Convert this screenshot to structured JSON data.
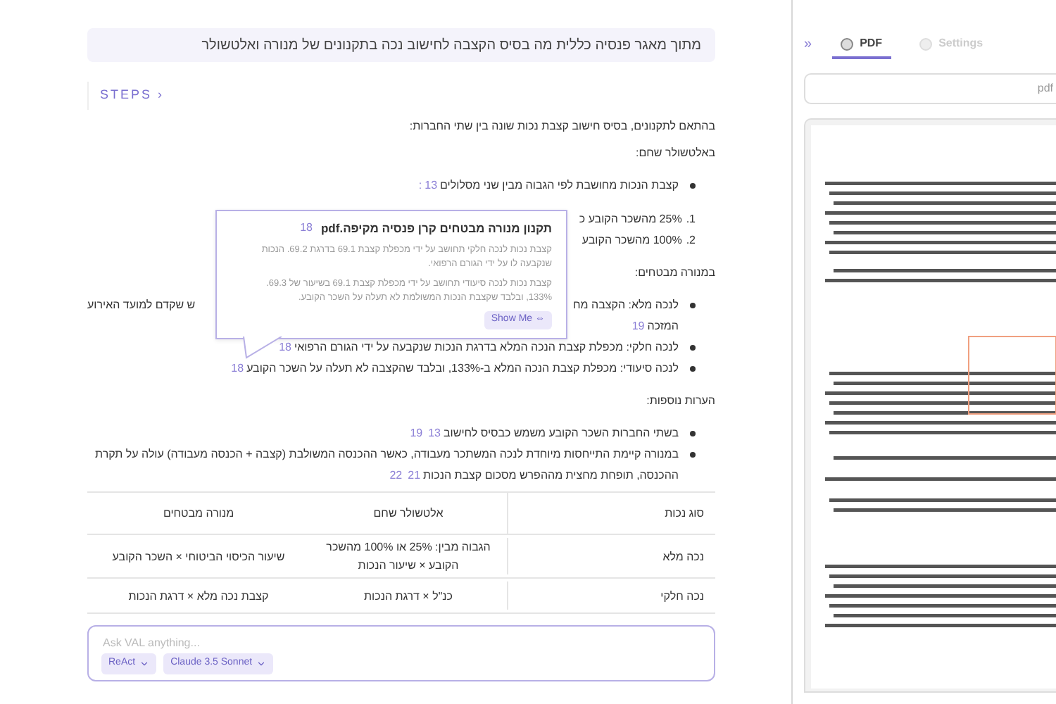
{
  "intro": "מתוך מאגר פנסיה כללית מה בסיס הקצבה לחישוב נכה בתקנונים של מנורה ואלטשולר",
  "steps_label": "STEPS",
  "steps_chevron": "›",
  "collapse_glyph": "»",
  "answer": [
    {
      "kind": "paragraph",
      "text": "בהתאם לתקנונים, בסיס חישוב קצבת נכות שונה בין שתי החברות:"
    },
    {
      "kind": "paragraph",
      "text": "באלטשולר שחם:"
    },
    {
      "kind": "bullets",
      "items": [
        {
          "lines": [
            [
              "קצבת הנכות מחושבת לפי הגבוה מבין שני מסלולים"
            ]
          ],
          "citations": [
            "13"
          ],
          "suffix": ":"
        }
      ]
    },
    {
      "kind": "numbered",
      "items": [
        {
          "number": "1.",
          "text": "25% מהשכר הקובע כ"
        },
        {
          "number": "2.",
          "text": "100% מהשכר הקובע"
        }
      ]
    },
    {
      "kind": "paragraph",
      "text": "במנורה מבטחים:"
    },
    {
      "kind": "bullets",
      "items": [
        {
          "lines": [
            [
              "לנכה מלא: הקצבה מח",
              "ש שקדם למועד האירוע"
            ],
            [
              "המזכה"
            ]
          ],
          "citations": [
            "19"
          ]
        },
        {
          "lines": [
            [
              "לנכה חלקי: מכפלת קצבת הנכה המלא בדרגת הנכות שנקבעה על ידי הגורם הרפואי"
            ]
          ],
          "citations": [
            "18"
          ]
        },
        {
          "lines": [
            [
              "לנכה סיעודי: מכפלת קצבת הנכה המלא ב-133%, ובלבד שהקצבה לא תעלה על השכר הקובע"
            ]
          ],
          "citations": [
            "18"
          ]
        }
      ]
    },
    {
      "kind": "paragraph",
      "text": "הערות נוספות:"
    },
    {
      "kind": "bullets",
      "items": [
        {
          "lines": [
            [
              "בשתי החברות השכר הקובע משמש כבסיס לחישוב"
            ]
          ],
          "citations": [
            "13",
            "19"
          ]
        },
        {
          "lines": [
            [
              "במנורה קיימת התייחסות מיוחדת לנכה המשתכר מעבודה, כאשר ההכנסה המשולבת (קצבה + הכנסה מעבודה) עולה על תקרת"
            ],
            [
              "ההכנסה, תופחת מחצית מההפרש מסכום קצבת הנכות"
            ]
          ],
          "citations": [
            "21",
            "22"
          ]
        }
      ]
    }
  ],
  "table": {
    "columns": [
      "סוג נכות",
      "אלטשולר שחם",
      "מנורה מבטחים"
    ],
    "rows": [
      [
        "נכה מלא",
        "הגבוה מבין: 25% או 100% מהשכר הקובע × שיעור הנכות",
        "שיעור הכיסוי הביטוחי × השכר הקובע"
      ],
      [
        "נכה חלקי",
        "כנ\"ל × דרגת הנכות",
        "קצבת נכה מלא × דרגת הנכות"
      ]
    ]
  },
  "popover": {
    "title": "תקנון מנורה מבטחים קרן פנסיה מקיפה.pdf",
    "citation": "18",
    "paragraphs": [
      "קצבת נכות לנכה חלקי תחושב על ידי מכפלת קצבת 69.1 בדרגת 69.2. הנכות שנקבעה לו על ידי הגורם הרפואי.",
      "קצבת נכות לנכה סיעודי תחושב על ידי מכפלת קצבת 69.1 בשיעור של 69.3. 133%, ובלבד שקצבת הנכות המשולמת לא תעלה על השכר הקובע."
    ],
    "button": "Show Me ⇔"
  },
  "composer": {
    "placeholder": "Ask VAL anything...",
    "chips": [
      "Claude 3.5 Sonnet",
      "ReAct"
    ]
  },
  "side_tabs": [
    {
      "label": "Settings",
      "selected": false
    },
    {
      "label": "PDF",
      "selected": true
    }
  ],
  "pdf_search": {
    "value": "pdf"
  }
}
